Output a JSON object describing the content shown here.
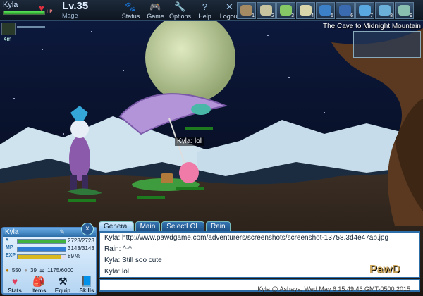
{
  "player": {
    "name": "Kyla",
    "level": "Lv.35",
    "class": "Mage",
    "hp_tag": "HP"
  },
  "menu": [
    {
      "label": "Status",
      "icon": "paw-icon"
    },
    {
      "label": "Game",
      "icon": "gamepad-icon"
    },
    {
      "label": "Options",
      "icon": "wrench-icon"
    },
    {
      "label": "Help",
      "icon": "help-icon"
    },
    {
      "label": "Logout",
      "icon": "close-icon"
    }
  ],
  "skillslots": [
    {
      "key": "1",
      "color": "#a58b64"
    },
    {
      "key": "2",
      "color": "#c8c4a0"
    },
    {
      "key": "3",
      "color": "#86c766"
    },
    {
      "key": "4",
      "color": "#d8d6aa"
    },
    {
      "key": "5",
      "color": "#3c80c8"
    },
    {
      "key": "6",
      "color": "#3a6ab0"
    },
    {
      "key": "7",
      "color": "#5aa8e0"
    },
    {
      "key": "8",
      "color": "#6ab0d8"
    },
    {
      "key": "9",
      "color": "#8ac0b0"
    }
  ],
  "buff": {
    "time": "4m"
  },
  "location": "The Cave to Midnight Mountain",
  "nametag": "Kyla: lol",
  "panel": {
    "name": "Kyla",
    "hp": {
      "label": "HP",
      "value": "2723/2723",
      "percent": 100
    },
    "mp": {
      "label": "MP",
      "value": "3143/3143",
      "percent": 100
    },
    "exp": {
      "label": "EXP",
      "value": "89 %",
      "percent": 89
    },
    "gold": "550",
    "silver": "39",
    "weight": "1175/6000",
    "actions": [
      {
        "label": "Stats",
        "icon": "heart-icon"
      },
      {
        "label": "Items",
        "icon": "bag-icon"
      },
      {
        "label": "Equip",
        "icon": "hammer-icon"
      },
      {
        "label": "Skills",
        "icon": "book-icon"
      }
    ]
  },
  "chat": {
    "tabs": [
      "General",
      "Main",
      "SelectLOL",
      "Rain"
    ],
    "messages": [
      "Kyla: http://www.pawdgame.com/adventurers/screenshots/screenshot-13758.3d4e47ab.jpg",
      "Rain: ^-^",
      "Kyla: Still soo cute",
      "Kyla: lol"
    ],
    "timestamp": "Kyla @ Ashaya, Wed May 6 15:49:46 GMT-0500 2015",
    "logo": "PawD"
  },
  "colors": {
    "hp": "#3fb23f",
    "mp": "#2f7cd6",
    "exp": "#d8b820",
    "sky": "#0b1430"
  }
}
